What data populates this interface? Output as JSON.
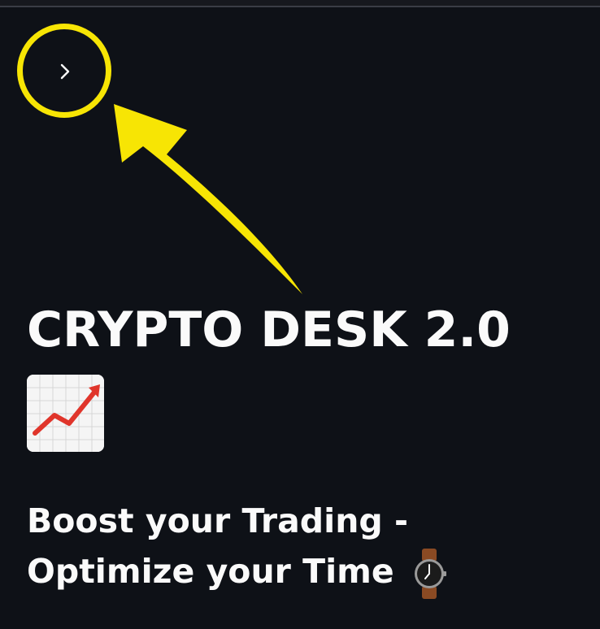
{
  "header": {
    "sidebar_toggle_label": ">"
  },
  "main": {
    "title": "CRYPTO DESK 2.0",
    "title_emoji": "chart-increasing-icon",
    "subtitle_line1": "Boost your Trading -",
    "subtitle_line2": "Optimize your Time",
    "subtitle_emoji": "watch-icon"
  },
  "colors": {
    "background": "#0e1117",
    "text": "#fafafa",
    "annotation": "#f7e504",
    "chart_line": "#e0352b"
  }
}
